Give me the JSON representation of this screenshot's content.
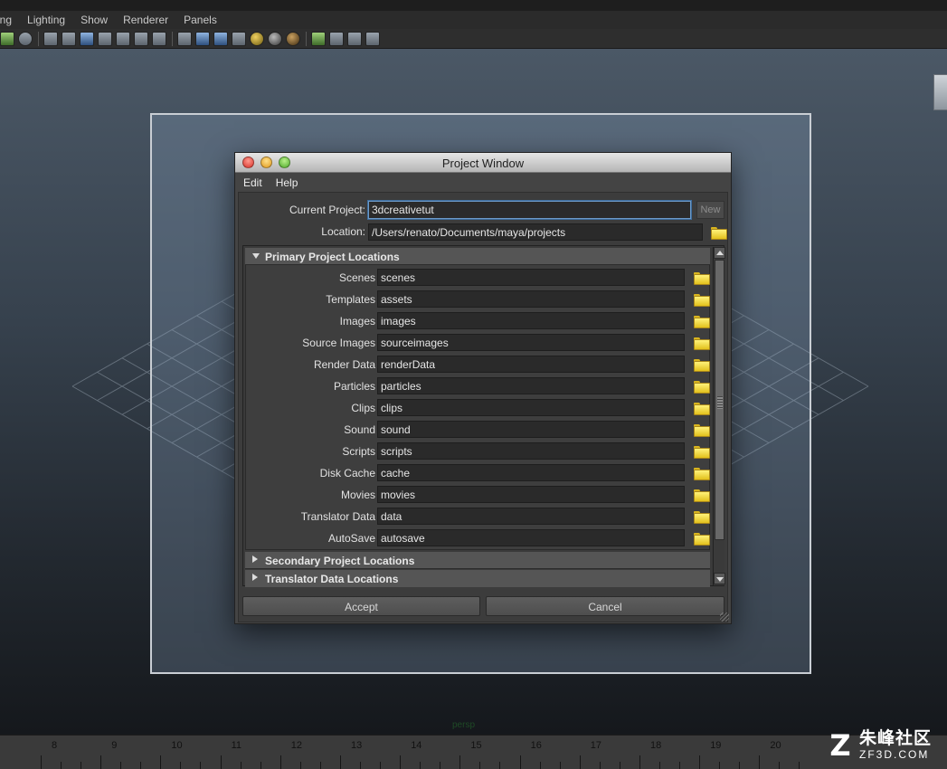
{
  "host_app": {
    "menu": [
      "ing",
      "Lighting",
      "Show",
      "Renderer",
      "Panels"
    ],
    "toolbar_icons": [
      "translate-icon",
      "magnet-icon",
      "wireframe-icon",
      "film-gate-icon",
      "camera-icon",
      "smooth-shade-icon",
      "xray-icon",
      "texture-icon",
      "text-icon",
      "cube-outline-icon",
      "cube-solid-icon",
      "cube-shaded-icon",
      "checker-icon",
      "light-gold-icon",
      "light-grey-icon",
      "light-brown-icon",
      "select-cursor-icon",
      "isolate-icon",
      "frame-icon",
      "graph-icon"
    ],
    "viewport_camera": "persp",
    "timeline_ticks": [
      "8",
      "9",
      "10",
      "11",
      "12",
      "13",
      "14",
      "15",
      "16",
      "17",
      "18",
      "19",
      "20"
    ]
  },
  "watermark": {
    "logo": "Z",
    "cn_text": "朱峰社区",
    "en_text": "ZF3D.COM"
  },
  "project_window": {
    "title": "Project Window",
    "menu": [
      "Edit",
      "Help"
    ],
    "current_project_label": "Current Project:",
    "current_project_value": "3dcreativetut",
    "new_button": "New",
    "location_label": "Location:",
    "location_value": "/Users/renato/Documents/maya/projects",
    "primary_section": "Primary Project Locations",
    "secondary_section": "Secondary Project Locations",
    "translator_section": "Translator Data Locations",
    "locations": [
      {
        "label": "Scenes",
        "value": "scenes"
      },
      {
        "label": "Templates",
        "value": "assets"
      },
      {
        "label": "Images",
        "value": "images"
      },
      {
        "label": "Source Images",
        "value": "sourceimages"
      },
      {
        "label": "Render Data",
        "value": "renderData"
      },
      {
        "label": "Particles",
        "value": "particles"
      },
      {
        "label": "Clips",
        "value": "clips"
      },
      {
        "label": "Sound",
        "value": "sound"
      },
      {
        "label": "Scripts",
        "value": "scripts"
      },
      {
        "label": "Disk Cache",
        "value": "cache"
      },
      {
        "label": "Movies",
        "value": "movies"
      },
      {
        "label": "Translator Data",
        "value": "data"
      },
      {
        "label": "AutoSave",
        "value": "autosave"
      }
    ],
    "accept_button": "Accept",
    "cancel_button": "Cancel"
  },
  "colors": {
    "dialog_bg": "#3c3c3c",
    "focus_outline": "#6d9ac9",
    "folder_yellow": "#f3d83a"
  }
}
